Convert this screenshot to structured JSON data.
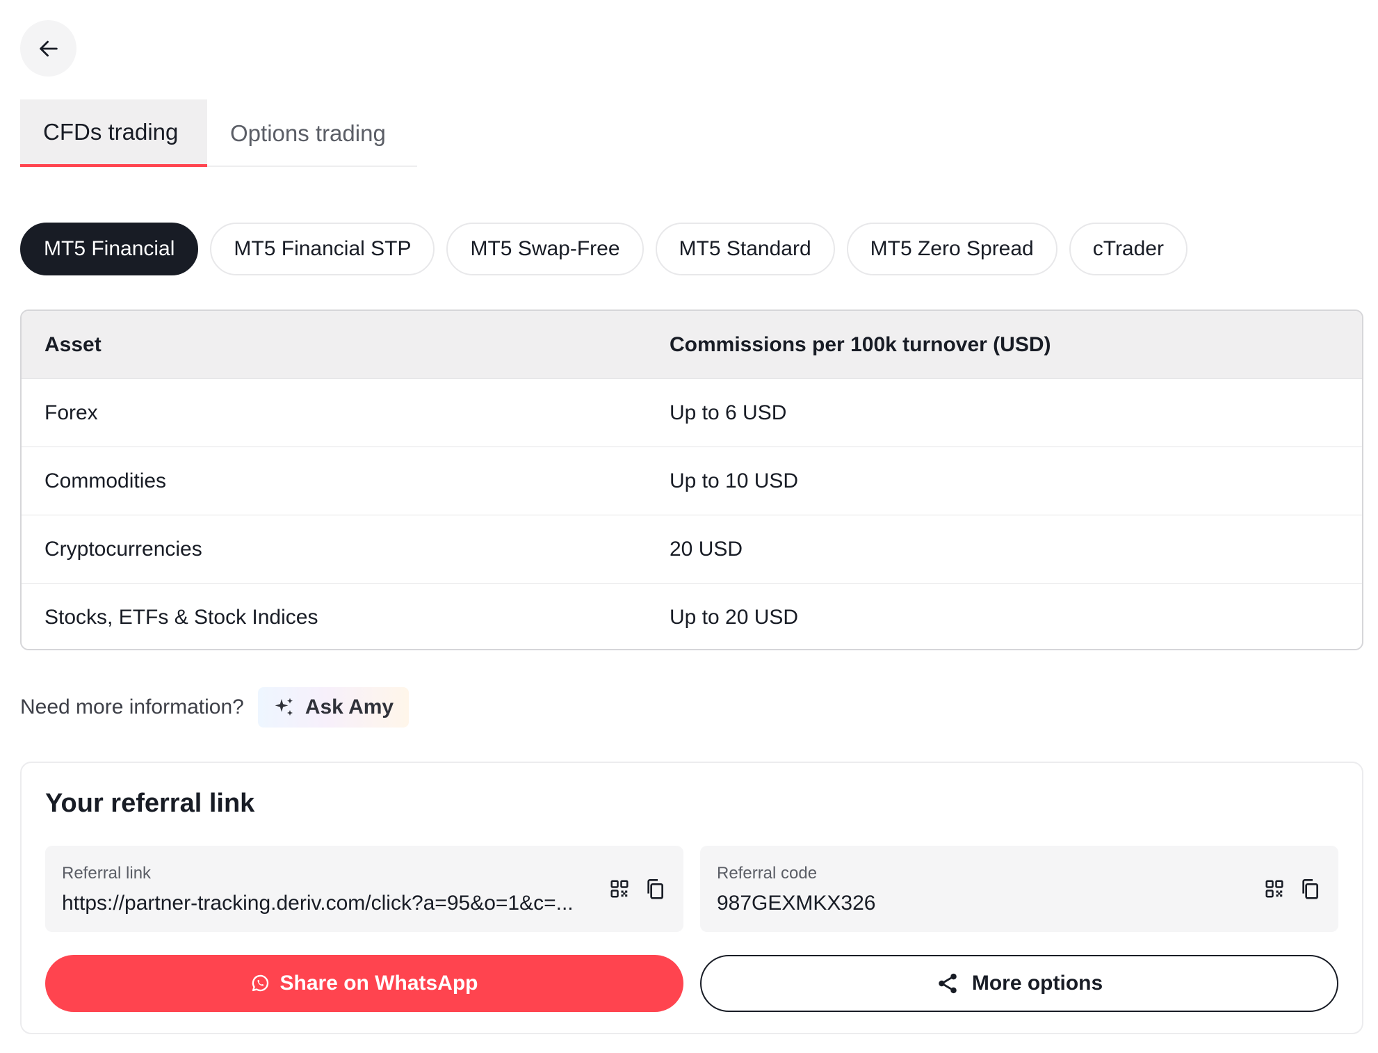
{
  "tabs": [
    {
      "label": "CFDs trading",
      "active": true
    },
    {
      "label": "Options trading",
      "active": false
    }
  ],
  "account_types": [
    {
      "label": "MT5 Financial",
      "active": true
    },
    {
      "label": "MT5 Financial STP",
      "active": false
    },
    {
      "label": "MT5 Swap-Free",
      "active": false
    },
    {
      "label": "MT5 Standard",
      "active": false
    },
    {
      "label": "MT5 Zero Spread",
      "active": false
    },
    {
      "label": "cTrader",
      "active": false
    }
  ],
  "table": {
    "headers": [
      "Asset",
      "Commissions per 100k turnover (USD)"
    ],
    "rows": [
      [
        "Forex",
        "Up to 6 USD"
      ],
      [
        "Commodities",
        "Up to 10 USD"
      ],
      [
        "Cryptocurrencies",
        "20 USD"
      ],
      [
        "Stocks, ETFs & Stock Indices",
        "Up to 20 USD"
      ]
    ]
  },
  "help": {
    "text": "Need more information?",
    "ask_label": "Ask Amy"
  },
  "referral": {
    "title": "Your referral link",
    "link_label": "Referral link",
    "link_value": "https://partner-tracking.deriv.com/click?a=95&o=1&c=...",
    "code_label": "Referral code",
    "code_value": "987GEXMKX326",
    "whatsapp_label": "Share on WhatsApp",
    "more_label": "More options"
  },
  "colors": {
    "accent": "#ff444f",
    "dark": "#181c25",
    "header_bg": "#f0eff0"
  }
}
